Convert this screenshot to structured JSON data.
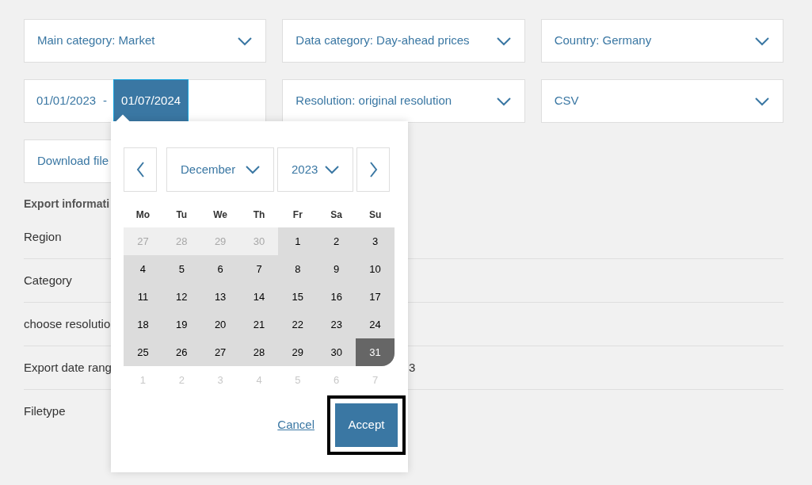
{
  "selects_row1": [
    {
      "label": "Main category: Market"
    },
    {
      "label": "Data category: Day-ahead prices"
    },
    {
      "label": "Country: Germany"
    }
  ],
  "date_range": {
    "fields": [
      {
        "value": "01/01/2023",
        "selected": false
      },
      {
        "value": "01/07/2024",
        "selected": true
      }
    ],
    "separator": "-"
  },
  "selects_row2": [
    {
      "label": "Resolution: original resolution"
    },
    {
      "label": "CSV"
    }
  ],
  "download_button": "Download file",
  "export_info": {
    "heading": "Export informati",
    "rows": [
      {
        "label": "Region",
        "value": ""
      },
      {
        "label": "Category",
        "value": ""
      },
      {
        "label": "choose resolutio",
        "value": ""
      },
      {
        "label": "Export date rang",
        "value": "3"
      },
      {
        "label": "Filetype",
        "value": ""
      }
    ]
  },
  "datepicker": {
    "month": "December",
    "year": "2023",
    "weekdays": [
      "Mo",
      "Tu",
      "We",
      "Th",
      "Fr",
      "Sa",
      "Su"
    ],
    "days": [
      {
        "label": "27",
        "kind": "prev"
      },
      {
        "label": "28",
        "kind": "prev"
      },
      {
        "label": "29",
        "kind": "prev"
      },
      {
        "label": "30",
        "kind": "prev"
      },
      {
        "label": "1",
        "kind": "range"
      },
      {
        "label": "2",
        "kind": "range"
      },
      {
        "label": "3",
        "kind": "range"
      },
      {
        "label": "4",
        "kind": "range"
      },
      {
        "label": "5",
        "kind": "range"
      },
      {
        "label": "6",
        "kind": "range"
      },
      {
        "label": "7",
        "kind": "range"
      },
      {
        "label": "8",
        "kind": "range"
      },
      {
        "label": "9",
        "kind": "range"
      },
      {
        "label": "10",
        "kind": "range"
      },
      {
        "label": "11",
        "kind": "range"
      },
      {
        "label": "12",
        "kind": "range"
      },
      {
        "label": "13",
        "kind": "range"
      },
      {
        "label": "14",
        "kind": "range"
      },
      {
        "label": "15",
        "kind": "range"
      },
      {
        "label": "16",
        "kind": "range"
      },
      {
        "label": "17",
        "kind": "range"
      },
      {
        "label": "18",
        "kind": "range"
      },
      {
        "label": "19",
        "kind": "range"
      },
      {
        "label": "20",
        "kind": "range"
      },
      {
        "label": "21",
        "kind": "range"
      },
      {
        "label": "22",
        "kind": "range"
      },
      {
        "label": "23",
        "kind": "range"
      },
      {
        "label": "24",
        "kind": "range"
      },
      {
        "label": "25",
        "kind": "range"
      },
      {
        "label": "26",
        "kind": "range"
      },
      {
        "label": "27",
        "kind": "range"
      },
      {
        "label": "28",
        "kind": "range"
      },
      {
        "label": "29",
        "kind": "range"
      },
      {
        "label": "30",
        "kind": "range"
      },
      {
        "label": "31",
        "kind": "selected"
      },
      {
        "label": "1",
        "kind": "next"
      },
      {
        "label": "2",
        "kind": "next"
      },
      {
        "label": "3",
        "kind": "next"
      },
      {
        "label": "4",
        "kind": "next"
      },
      {
        "label": "5",
        "kind": "next"
      },
      {
        "label": "6",
        "kind": "next"
      },
      {
        "label": "7",
        "kind": "next"
      }
    ],
    "cancel": "Cancel",
    "accept": {
      "label": "Accept",
      "focused": true
    }
  }
}
